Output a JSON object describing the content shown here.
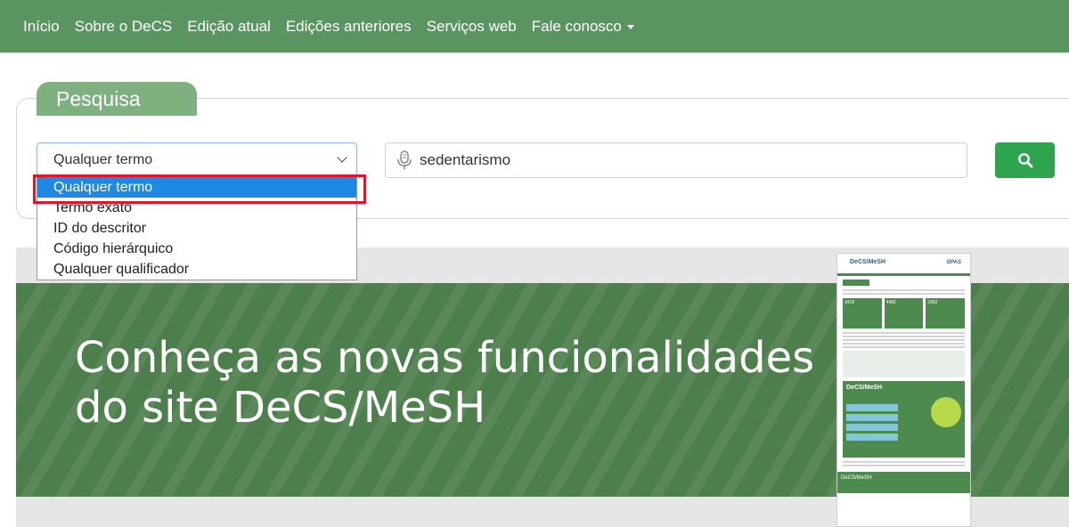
{
  "nav": {
    "items": [
      {
        "label": "Início"
      },
      {
        "label": "Sobre o DeCS"
      },
      {
        "label": "Edição atual"
      },
      {
        "label": "Edições anteriores"
      },
      {
        "label": "Serviços web"
      },
      {
        "label": "Fale conosco"
      }
    ]
  },
  "search": {
    "tab_label": "Pesquisa",
    "select_value": "Qualquer termo",
    "options": [
      "Qualquer termo",
      "Termo exato",
      "ID do descritor",
      "Código hierárquico",
      "Qualquer qualificador"
    ],
    "query": "sedentarismo"
  },
  "banner": {
    "line1": "Conheça as novas funcionalidades",
    "line2": "do site DeCS/MeSH",
    "thumbnail": {
      "logo": "DeCS/MeSH",
      "partner": "OPAS",
      "tiles": [
        "3418",
        "4482",
        "2962"
      ],
      "big_title": "DeCS/MeSH",
      "footer": "DeCS/MeSH"
    }
  },
  "colors": {
    "nav_bg": "#5a9460",
    "accent_green": "#2ea44f",
    "selected_option": "#1e88e5",
    "highlight": "#e0142b"
  }
}
